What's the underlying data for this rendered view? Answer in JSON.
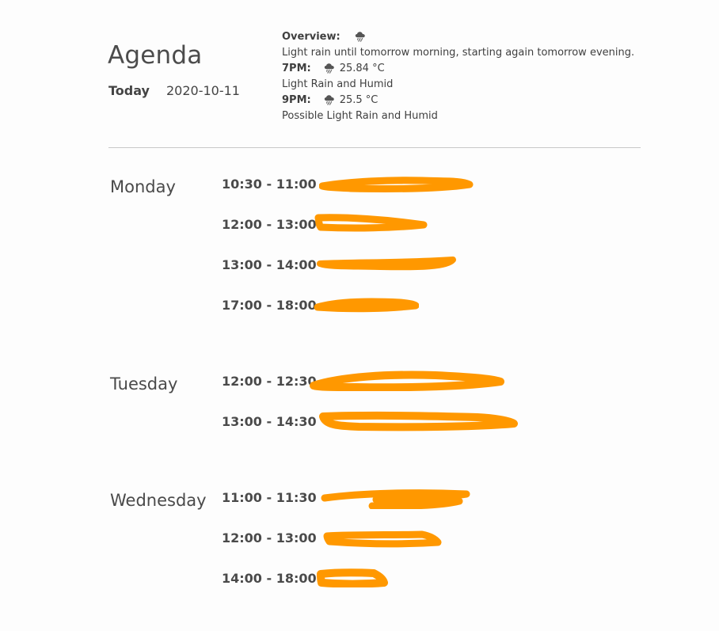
{
  "header": {
    "title": "Agenda",
    "today_label": "Today",
    "today_date": "2020-10-11"
  },
  "weather": {
    "overview_label": "Overview:",
    "overview_icon": "rain-cloud-icon",
    "summary": "Light rain until tomorrow morning, starting again tomorrow evening.",
    "hours": [
      {
        "time": "7PM:",
        "icon": "rain-cloud-icon",
        "temp": "25.84 °C",
        "desc": "Light Rain and Humid"
      },
      {
        "time": "9PM:",
        "icon": "rain-cloud-icon",
        "temp": "25.5 °C",
        "desc": "Possible Light Rain and Humid"
      }
    ]
  },
  "colors": {
    "redaction": "#ff9800",
    "divider": "#c8c8c8"
  },
  "days": [
    {
      "name": "Monday",
      "events": [
        {
          "time": "10:30 - 11:00",
          "title": "[redacted]"
        },
        {
          "time": "12:00 - 13:00",
          "title": "[redacted]"
        },
        {
          "time": "13:00 - 14:00",
          "title": "[redacted]"
        },
        {
          "time": "17:00 - 18:00",
          "title": "[redacted]"
        }
      ]
    },
    {
      "name": "Tuesday",
      "events": [
        {
          "time": "12:00 - 12:30",
          "title": "[redacted]"
        },
        {
          "time": "13:00 - 14:30",
          "title": "[redacted]"
        }
      ]
    },
    {
      "name": "Wednesday",
      "events": [
        {
          "time": "11:00 - 11:30",
          "title": "[redacted]"
        },
        {
          "time": "12:00 - 13:00",
          "title": "[redacted]"
        },
        {
          "time": "14:00 - 18:00",
          "title": "[redacted]"
        }
      ]
    }
  ]
}
